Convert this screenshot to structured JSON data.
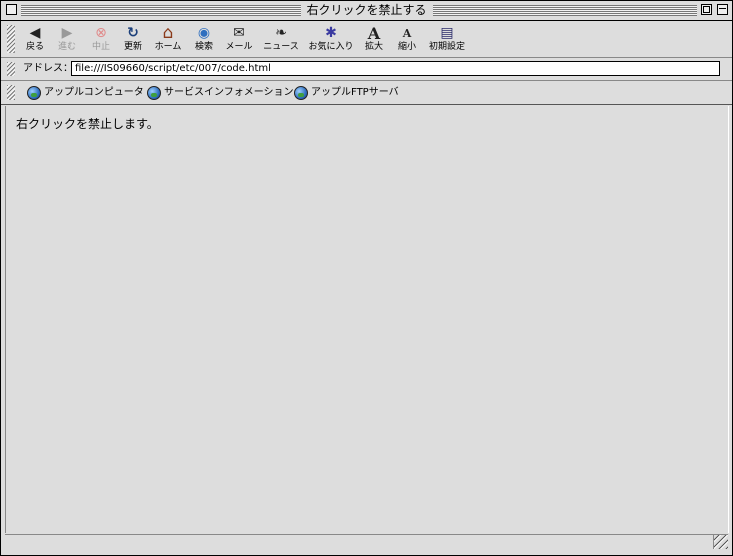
{
  "window": {
    "title": "右クリックを禁止する"
  },
  "toolbar": {
    "buttons": [
      {
        "label": "戻る",
        "icon": "back-arrow-icon",
        "glyph": "◀",
        "enabled": true
      },
      {
        "label": "進む",
        "icon": "forward-arrow-icon",
        "glyph": "▶",
        "enabled": false
      },
      {
        "label": "中止",
        "icon": "stop-icon",
        "glyph": "⊗",
        "enabled": false
      },
      {
        "label": "更新",
        "icon": "refresh-icon",
        "glyph": "↻",
        "enabled": true
      },
      {
        "label": "ホーム",
        "icon": "home-icon",
        "glyph": "⌂",
        "enabled": true
      },
      {
        "label": "検索",
        "icon": "search-globe-icon",
        "glyph": "◉",
        "enabled": true
      },
      {
        "label": "メール",
        "icon": "mail-icon",
        "glyph": "✉",
        "enabled": true
      },
      {
        "label": "ニュース",
        "icon": "news-icon",
        "glyph": "❧",
        "enabled": true
      },
      {
        "label": "お気に入り",
        "icon": "favorites-icon",
        "glyph": "✱",
        "enabled": true
      },
      {
        "label": "拡大",
        "icon": "font-larger-icon",
        "glyph": "A",
        "enabled": true
      },
      {
        "label": "縮小",
        "icon": "font-smaller-icon",
        "glyph": "A",
        "enabled": true
      },
      {
        "label": "初期設定",
        "icon": "preferences-icon",
        "glyph": "▤",
        "enabled": true
      }
    ]
  },
  "address": {
    "label": "アドレス：",
    "value": "file:///IS09660/script/etc/007/code.html"
  },
  "favorites": [
    {
      "label": "アップルコンピュータ",
      "icon": "globe-icon"
    },
    {
      "label": "サービスインフォメーション",
      "icon": "globe-icon"
    },
    {
      "label": "アップルFTPサーバ",
      "icon": "globe-icon"
    }
  ],
  "content": {
    "text": "右クリックを禁止します。"
  },
  "colors": {
    "chrome": "#dddddd",
    "stop": "#d04040",
    "accent": "#2f6fbf"
  }
}
